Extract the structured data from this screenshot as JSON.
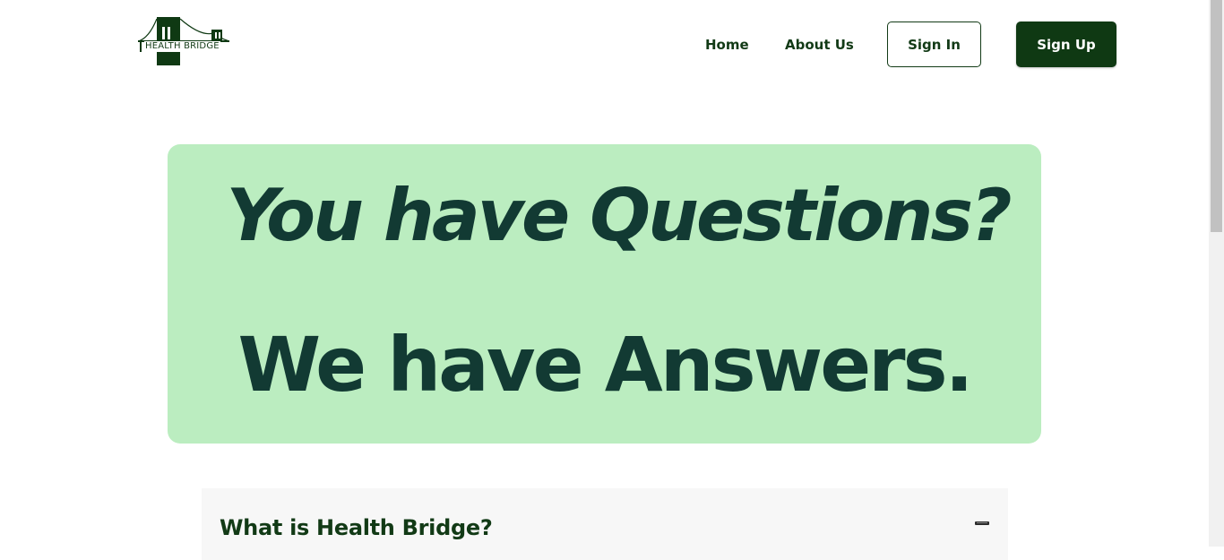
{
  "header": {
    "logo_text": "HEALTH BRIDGE",
    "nav": [
      {
        "label": "Home"
      },
      {
        "label": "About Us"
      }
    ],
    "sign_in_label": "Sign In",
    "sign_up_label": "Sign Up"
  },
  "hero": {
    "line1": "You have Questions?",
    "line2": "We have Answers."
  },
  "faq": {
    "items": [
      {
        "question": "What is Health Bridge?",
        "expanded": true,
        "toggle_icon": "minus-icon"
      }
    ]
  },
  "colors": {
    "brand_dark": "#0f3913",
    "hero_background": "#bbedc0",
    "hero_text": "#123a33",
    "faq_background": "#f7f7f7"
  }
}
